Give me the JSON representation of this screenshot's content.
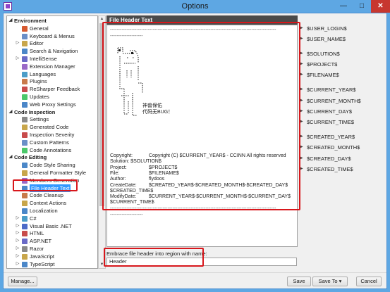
{
  "window": {
    "title": "Options"
  },
  "titlebar_buttons": {
    "minimize": "—",
    "maximize": "□",
    "close": "✕"
  },
  "tree": {
    "rows": [
      {
        "kind": "cat",
        "label": "Environment",
        "expander": "◢"
      },
      {
        "kind": "item",
        "label": "General",
        "icon_color": "#d65a31"
      },
      {
        "kind": "item",
        "label": "Keyboard & Menus",
        "icon_color": "#6a8fc7"
      },
      {
        "kind": "item",
        "label": "Editor",
        "icon_color": "#c8a64b",
        "expander": "▷"
      },
      {
        "kind": "item",
        "label": "Search & Navigation",
        "icon_color": "#4b87c8"
      },
      {
        "kind": "item",
        "label": "IntelliSense",
        "icon_color": "#6a6ac7",
        "expander": "▷"
      },
      {
        "kind": "item",
        "label": "Extension Manager",
        "icon_color": "#9a6ac7"
      },
      {
        "kind": "item",
        "label": "Languages",
        "icon_color": "#4b9dc8"
      },
      {
        "kind": "item",
        "label": "Plugins",
        "icon_color": "#c87a4b"
      },
      {
        "kind": "item",
        "label": "ReSharper Feedback",
        "icon_color": "#c84b4b"
      },
      {
        "kind": "item",
        "label": "Updates",
        "icon_color": "#4bc86a"
      },
      {
        "kind": "item",
        "label": "Web Proxy Settings",
        "icon_color": "#4b87c8"
      },
      {
        "kind": "cat",
        "label": "Code Inspection",
        "expander": "◢"
      },
      {
        "kind": "item",
        "label": "Settings",
        "icon_color": "#8a8a8a"
      },
      {
        "kind": "item",
        "label": "Generated Code",
        "icon_color": "#c8a64b"
      },
      {
        "kind": "item",
        "label": "Inspection Severity",
        "icon_color": "#c84b4b"
      },
      {
        "kind": "item",
        "label": "Custom Patterns",
        "icon_color": "#6a8fc7"
      },
      {
        "kind": "item",
        "label": "Code Annotations",
        "icon_color": "#4bc86a"
      },
      {
        "kind": "cat",
        "label": "Code Editing",
        "expander": "◢"
      },
      {
        "kind": "item",
        "label": "Code Style Sharing",
        "icon_color": "#4b87c8"
      },
      {
        "kind": "item",
        "label": "General Formatter Style",
        "icon_color": "#c8a64b"
      },
      {
        "kind": "item",
        "label": "Members Generation",
        "icon_color": "#9a6ac7"
      },
      {
        "kind": "item",
        "label": "File Header Text",
        "icon_color": "#4b87c8",
        "selected": true
      },
      {
        "kind": "item",
        "label": "Code Cleanup",
        "icon_color": "#c87a4b"
      },
      {
        "kind": "item",
        "label": "Context Actions",
        "icon_color": "#c8a64b"
      },
      {
        "kind": "item",
        "label": "Localization",
        "icon_color": "#4b87c8"
      },
      {
        "kind": "item",
        "label": "C#",
        "icon_color": "#4b9dc8",
        "expander": "▷"
      },
      {
        "kind": "item",
        "label": "Visual Basic .NET",
        "icon_color": "#4b6ac8",
        "expander": "▷"
      },
      {
        "kind": "item",
        "label": "HTML",
        "icon_color": "#c84b4b",
        "expander": "▷"
      },
      {
        "kind": "item",
        "label": "ASP.NET",
        "icon_color": "#6a6ac7",
        "expander": "▷"
      },
      {
        "kind": "item",
        "label": "Razor",
        "icon_color": "#8a8a8a",
        "expander": "▷"
      },
      {
        "kind": "item",
        "label": "JavaScript",
        "icon_color": "#c8a64b",
        "expander": "▷"
      },
      {
        "kind": "item",
        "label": "TypeScript",
        "icon_color": "#4b87c8",
        "expander": "▷"
      }
    ]
  },
  "section": {
    "title": "File Header Text"
  },
  "editor": {
    "dash_line": "-----------------------------------------------------------------------------------------------------",
    "dash_short": "--------------------",
    "ascii_caption_1": "神兽保佑",
    "ascii_caption_2": "代码无BUG！",
    "header_rows": [
      {
        "key": "Copyright:",
        "value": "Copyright (C) $CURRENT_YEAR$ - CCINN All rights reserved"
      },
      {
        "key": "Solution: $SOLUTION$",
        "value": ""
      },
      {
        "key": "Project:",
        "value": "$PROJECT$"
      },
      {
        "key": "File:",
        "value": "$FILENAME$"
      },
      {
        "key": "Author:",
        "value": "flydoos"
      },
      {
        "key": "CreateDate:",
        "value": "$CREATED_YEAR$-$CREATED_MONTH$-$CREATED_DAY$"
      },
      {
        "key": "$CREATED_TIME$",
        "value": ""
      },
      {
        "key": "ModifyDate:",
        "value": "$CURRENT_YEAR$-$CURRENT_MONTH$-$CURRENT_DAY$"
      },
      {
        "key": "$CURRENT_TIME$",
        "value": ""
      }
    ]
  },
  "macros": [
    "$USER_LOGIN$",
    "$USER_NAME$",
    "$SOLUTION$",
    "$PROJECT$",
    "$FILENAME$",
    "$CURRENT_YEAR$",
    "$CURRENT_MONTH$",
    "$CURRENT_DAY$",
    "$CURRENT_TIME$",
    "$CREATED_YEAR$",
    "$CREATED_MONTH$",
    "$CREATED_DAY$",
    "$CREATED_TIME$"
  ],
  "region": {
    "label": "Embrace file header into region with name:",
    "value": "Header"
  },
  "footer": {
    "manage": "Manage...",
    "save": "Save",
    "save_to": "Save To ▾",
    "cancel": "Cancel"
  },
  "colors": {
    "highlight": "#d8171c",
    "selection": "#3399ff",
    "titlebar": "#5ea7e3",
    "section_header": "#4a4a4a"
  }
}
